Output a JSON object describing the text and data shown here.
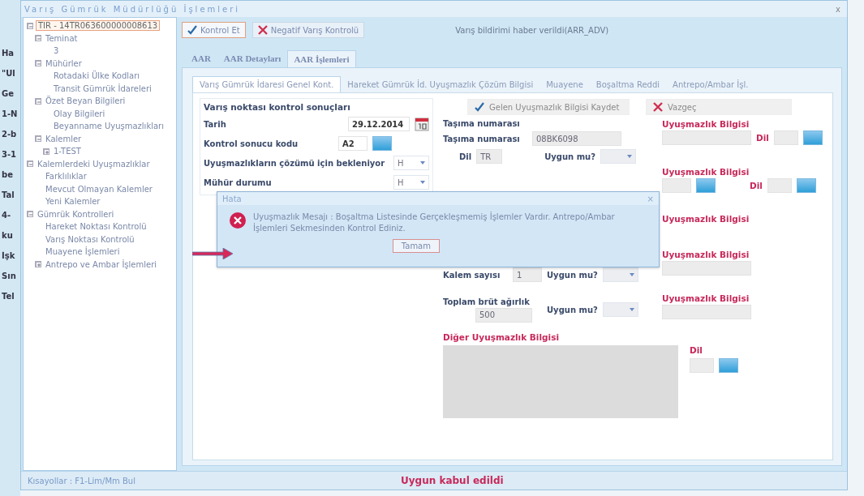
{
  "background_fragments": [
    "Ha",
    "\"Ul",
    "Ge",
    "1-N",
    "2-b",
    "3-1",
    "be",
    "Tal",
    "4-",
    "ku",
    "İşk",
    "Sın",
    "Tel"
  ],
  "window": {
    "title": "Varış Gümrük Müdürlüğü İşlemleri",
    "close": "x"
  },
  "tree": [
    {
      "label": "TIR - 14TR063600000008613",
      "selected": true,
      "expanded": true,
      "children": [
        {
          "label": "Teminat",
          "selected": false,
          "expanded": true,
          "children": [
            {
              "label": "3",
              "selected": false
            }
          ]
        },
        {
          "label": "Mühürler",
          "selected": false,
          "expanded": true,
          "children": [
            {
              "label": "Rotadaki Ülke Kodları",
              "selected": false
            },
            {
              "label": "Transit Gümrük İdareleri",
              "selected": false
            }
          ]
        },
        {
          "label": "Özet Beyan Bilgileri",
          "selected": false,
          "expanded": true,
          "children": [
            {
              "label": "Olay Bilgileri",
              "selected": false
            },
            {
              "label": "Beyanname Uyuşmazlıkları",
              "selected": false
            }
          ]
        },
        {
          "label": "Kalemler",
          "selected": false,
          "expanded": true,
          "children": [
            {
              "label": "1-TEST",
              "selected": false,
              "expanded": false
            }
          ]
        }
      ]
    },
    {
      "label": "Kalemlerdeki Uyuşmazlıklar",
      "selected": false,
      "expanded": true,
      "children": [
        {
          "label": "Farklılıklar",
          "selected": false
        },
        {
          "label": "Mevcut Olmayan Kalemler",
          "selected": false
        },
        {
          "label": "Yeni Kalemler",
          "selected": false
        }
      ]
    },
    {
      "label": "Gümrük Kontrolleri",
      "selected": false,
      "expanded": true,
      "children": [
        {
          "label": "Hareket Noktası Kontrolü",
          "selected": false
        },
        {
          "label": "Varış Noktası Kontrolü",
          "selected": false
        },
        {
          "label": "Muayene İşlemleri",
          "selected": false
        },
        {
          "label": "Antrepo ve Ambar İşlemleri",
          "selected": false,
          "expanded": false
        }
      ]
    }
  ],
  "toolbar": {
    "buttons": [
      {
        "label": "Kontrol Et",
        "kind": "check"
      },
      {
        "label": "Negatif Varış Kontrolü",
        "kind": "cross"
      }
    ],
    "message": "Varış bildirimi haber verildi(ARR_ADV)"
  },
  "tabs": [
    {
      "label": "AAR",
      "selected": false
    },
    {
      "label": "AAR Detayları",
      "selected": false
    },
    {
      "label": "AAR İşlemleri",
      "selected": true
    }
  ],
  "subtabs": [
    {
      "label": "Varış Gümrük İdaresi Genel Kont.",
      "selected": true
    },
    {
      "label": "Hareket Gümrük İd. Uyuşmazlık Çözüm Bilgisi",
      "selected": false
    },
    {
      "label": "Muayene",
      "selected": false
    },
    {
      "label": "Boşaltma Reddi",
      "selected": false
    },
    {
      "label": "Antrepo/Ambar İşl.",
      "selected": false
    }
  ],
  "arrival_results": {
    "heading": "Varış noktası kontrol sonuçları",
    "date_label": "Tarih",
    "date": "29.12.2014",
    "code_label": "Kontrol sonucu kodu",
    "code": "A2",
    "awaiting_label": "Uyuşmazlıkların çözümü için bekleniyor",
    "awaiting": "H",
    "seal_label": "Mühür durumu",
    "seal": "H"
  },
  "actions": [
    {
      "label": "Gelen Uyuşmazlık Bilgisi Kaydet",
      "kind": "check",
      "disabled": true
    },
    {
      "label": "Vazgeç",
      "kind": "cross",
      "disabled": true
    }
  ],
  "transport": {
    "heading": "Taşıma numarası",
    "label": "Taşıma numarası",
    "value": "08BK6098",
    "lang_label": "Dil",
    "lang": "TR",
    "ok_label": "Uygun mu?"
  },
  "dispute_blocks": [
    {
      "label": "Uyuşmazlık Bilgisi",
      "kind": "text_lang",
      "lang_label": "Dil"
    },
    {
      "label": "Uyuşmazlık Bilgisi",
      "kind": "lookup_lang",
      "lang_label": "Dil"
    },
    {
      "label": "Uyuşmazlık Bilgisi",
      "kind": "plain"
    },
    {
      "label": "Uyuşmazlık Bilgisi",
      "kind": "text"
    },
    {
      "label": "Uyuşmazlık Bilgisi",
      "kind": "text"
    }
  ],
  "item_count": {
    "label": "Kalem sayısı",
    "value": "1",
    "ok_label": "Uygun mu?"
  },
  "gross_weight": {
    "label": "Toplam brüt ağırlık",
    "value": "500",
    "ok_label": "Uygun mu?"
  },
  "other_dispute": {
    "heading": "Diğer Uyuşmazlık Bilgisi",
    "lang_label": "Dil"
  },
  "dialog": {
    "title": "Hata",
    "close": "×",
    "message": "Uyuşmazlık Mesajı : Boşaltma Listesinde Gerçekleşmemiş İşlemler Vardır. Antrepo/Ambar İşlemleri Sekmesinden Kontrol Ediniz.",
    "button": "Tamam"
  },
  "status_bar": {
    "shortcuts": "Kısayollar : F1-Lim/Mm Bul",
    "message": "Uygun kabul edildi"
  }
}
